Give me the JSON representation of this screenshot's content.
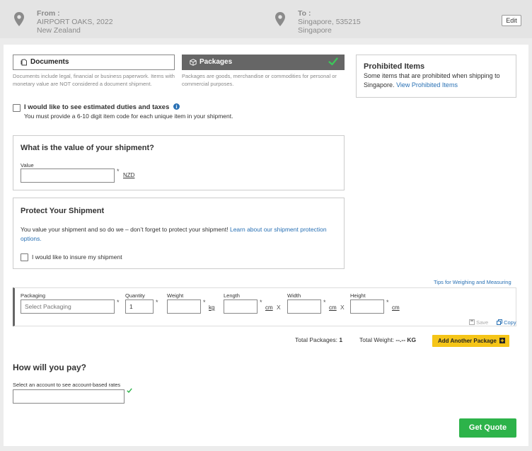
{
  "header": {
    "from_label": "From :",
    "from_line1": "AIRPORT OAKS, 2022",
    "from_line2": "New Zealand",
    "to_label": "To :",
    "to_line1": "Singapore, 535215",
    "to_line2": "Singapore",
    "edit_label": "Edit"
  },
  "tabs": {
    "documents_label": "Documents",
    "packages_label": "Packages",
    "documents_desc1": "Documents include legal, financial or business paperwork. Items with",
    "documents_desc2": "monetary value are NOT considered a document shipment.",
    "packages_desc1": "Packages are goods, merchandise or commodities for personal or",
    "packages_desc2": "commercial purposes."
  },
  "prohibited": {
    "title": "Prohibited Items",
    "text1": "Some items that are prohibited when shipping to",
    "text2": "Singapore.",
    "link": "View Prohibited Items"
  },
  "duties": {
    "label": "I would like to see estimated duties and taxes",
    "info_icon": "info-icon",
    "note": "You must provide a 6-10 digit item code for each unique item in your shipment."
  },
  "value_section": {
    "title": "What is the value of your shipment?",
    "value_label": "Value",
    "value": "",
    "required": "*",
    "currency": "NZD"
  },
  "protect": {
    "title": "Protect Your Shipment",
    "text1": "You value your shipment and so do we – don’t forget to protect your shipment!",
    "link1": "Learn about our shipment",
    "link2": "protection options.",
    "insure_label": "I would like to insure my shipment"
  },
  "package": {
    "tips_link": "Tips for Weighing and Measuring",
    "packaging_label": "Packaging",
    "packaging_placeholder": "Select Packaging",
    "quantity_label": "Quantity",
    "quantity_value": "1",
    "weight_label": "Weight",
    "weight_unit": "kg",
    "length_label": "Length",
    "width_label": "Width",
    "height_label": "Height",
    "dim_unit": "cm",
    "times": "X",
    "required": "*",
    "save_label": "Save",
    "copy_label": "Copy"
  },
  "totals": {
    "packages_label": "Total Packages:",
    "packages_value": "1",
    "weight_label": "Total Weight:",
    "weight_value": "--.-- KG",
    "add_button": "Add Another Package"
  },
  "payment": {
    "title": "How will you pay?",
    "account_label": "Select an account to see account-based rates",
    "account_value": ""
  },
  "get_quote_label": "Get Quote",
  "colors": {
    "accent_yellow": "#f5c518",
    "accent_green": "#2db34a",
    "link_blue": "#2870b4",
    "check_green": "#2db34a"
  }
}
